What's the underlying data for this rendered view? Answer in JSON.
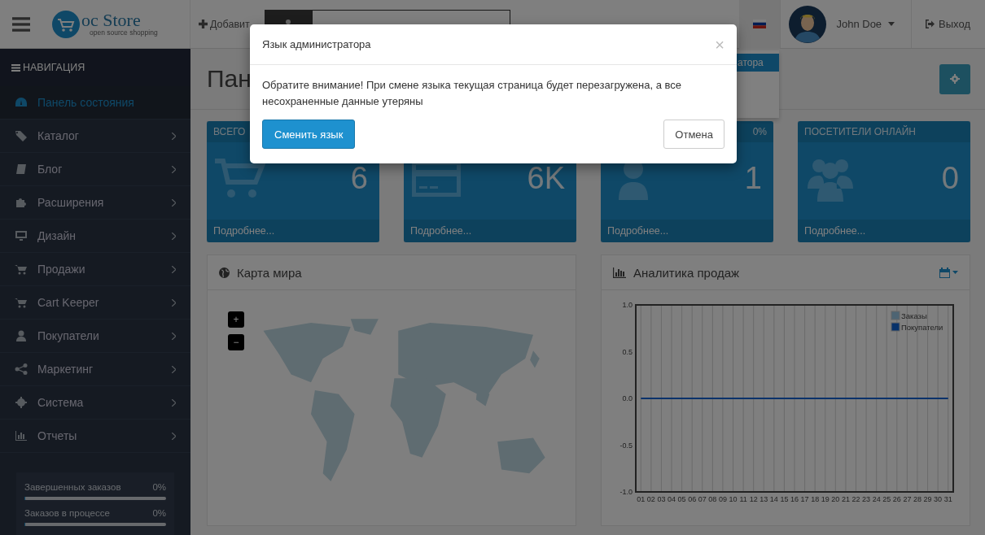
{
  "header": {
    "logo_text": "oc Store",
    "logo_tagline": "open source shopping",
    "add_button": "Добавит",
    "user_name": "John Doe",
    "logout": "Выход"
  },
  "language_menu": {
    "items": [
      {
        "label": "атора",
        "selected": true
      }
    ]
  },
  "sidebar": {
    "title": "НАВИГАЦИЯ",
    "items": [
      {
        "label": "Панель состояния",
        "selected": true,
        "has_children": false
      },
      {
        "label": "Каталог",
        "selected": false,
        "has_children": true
      },
      {
        "label": "Блог",
        "selected": false,
        "has_children": true
      },
      {
        "label": "Расширения",
        "selected": false,
        "has_children": true
      },
      {
        "label": "Дизайн",
        "selected": false,
        "has_children": true
      },
      {
        "label": "Продажи",
        "selected": false,
        "has_children": true
      },
      {
        "label": "Cart Keeper",
        "selected": false,
        "has_children": true
      },
      {
        "label": "Покупатели",
        "selected": false,
        "has_children": true
      },
      {
        "label": "Маркетинг",
        "selected": false,
        "has_children": true
      },
      {
        "label": "Система",
        "selected": false,
        "has_children": true
      },
      {
        "label": "Отчеты",
        "selected": false,
        "has_children": true
      }
    ],
    "stats": [
      {
        "label": "Завершенных заказов",
        "reading": "0%",
        "level": 0
      },
      {
        "label": "Заказов в процессе",
        "reading": "0%",
        "level": 0
      }
    ]
  },
  "page": {
    "title": "Пан"
  },
  "tiles": [
    {
      "title": "ВСЕГО",
      "value": "6",
      "link": "Подробнее..."
    },
    {
      "value": "6K",
      "link": "Подробнее..."
    },
    {
      "percent": "0%",
      "value": "1",
      "link": "Подробнее..."
    },
    {
      "title": "ПОСЕТИТЕЛИ ОНЛАЙН",
      "value": "0",
      "link": "Подробнее..."
    }
  ],
  "map_panel": {
    "title": "Карта мира",
    "zoom_in": "+",
    "zoom_out": "−"
  },
  "sales_panel": {
    "title": "Аналитика продаж",
    "chart_data": {
      "type": "line",
      "categories": [
        "01",
        "02",
        "03",
        "04",
        "05",
        "06",
        "07",
        "08",
        "09",
        "10",
        "11",
        "12",
        "13",
        "14",
        "15",
        "16",
        "17",
        "18",
        "19",
        "20",
        "21",
        "22",
        "23",
        "24",
        "25",
        "26",
        "27",
        "28",
        "29",
        "30",
        "31"
      ],
      "ylim": [
        -1,
        1
      ],
      "grid": true,
      "legend": "top-right",
      "yticks": [
        {
          "value": 1,
          "label": "1.0"
        },
        {
          "value": 0.5,
          "label": "0.5"
        },
        {
          "value": 0,
          "label": "0.0"
        },
        {
          "value": -0.5,
          "label": "-0.5"
        },
        {
          "value": -1,
          "label": "-1.0"
        }
      ],
      "series": [
        {
          "name": "Заказы",
          "color": "#4d6473",
          "values": [
            null,
            null,
            null,
            null,
            null,
            null,
            null,
            null,
            null,
            null,
            null,
            null,
            null,
            null,
            null,
            null,
            null,
            null,
            null,
            null,
            null,
            null,
            null,
            null,
            null,
            null,
            null,
            null,
            null,
            null,
            null
          ]
        },
        {
          "name": "Покупатели",
          "color": "#08326a",
          "values": [
            0,
            0,
            0,
            0,
            0,
            0,
            0,
            0,
            0,
            0,
            0,
            0,
            0,
            0,
            0,
            0,
            0,
            0,
            0,
            0,
            0,
            0,
            0,
            0,
            0,
            0,
            0,
            0,
            0,
            0,
            0
          ]
        }
      ]
    }
  },
  "modal": {
    "title": "Язык администратора",
    "close": "×",
    "message": "Обратите внимание! При смене языка текущая страница будет перезагружена, а все несохраненные данные утеряны",
    "confirm": "Сменить язык",
    "cancel": "Отмена"
  }
}
